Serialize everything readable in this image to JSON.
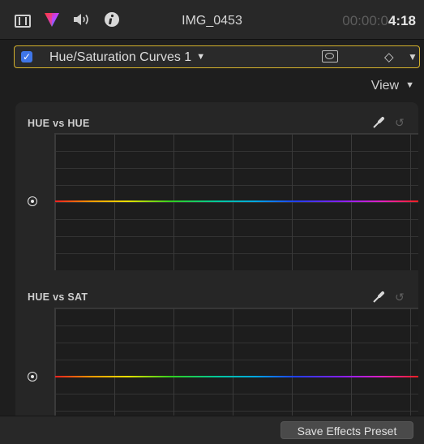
{
  "header": {
    "clip_name": "IMG_0453",
    "timecode_dim": "00:00:0",
    "timecode_bright": "4:18",
    "icons": [
      "film-icon",
      "color-triangle-icon",
      "speaker-icon",
      "info-icon"
    ]
  },
  "effect": {
    "enabled": true,
    "name": "Hue/Saturation Curves 1",
    "keyframe_glyph": "◇"
  },
  "view_menu": {
    "label": "View"
  },
  "curves": [
    {
      "label": "HUE vs HUE"
    },
    {
      "label": "HUE vs SAT"
    }
  ],
  "footer": {
    "save_label": "Save Effects Preset"
  },
  "colors": {
    "accent_border": "#d4b12c",
    "checkbox": "#3f76e8"
  }
}
